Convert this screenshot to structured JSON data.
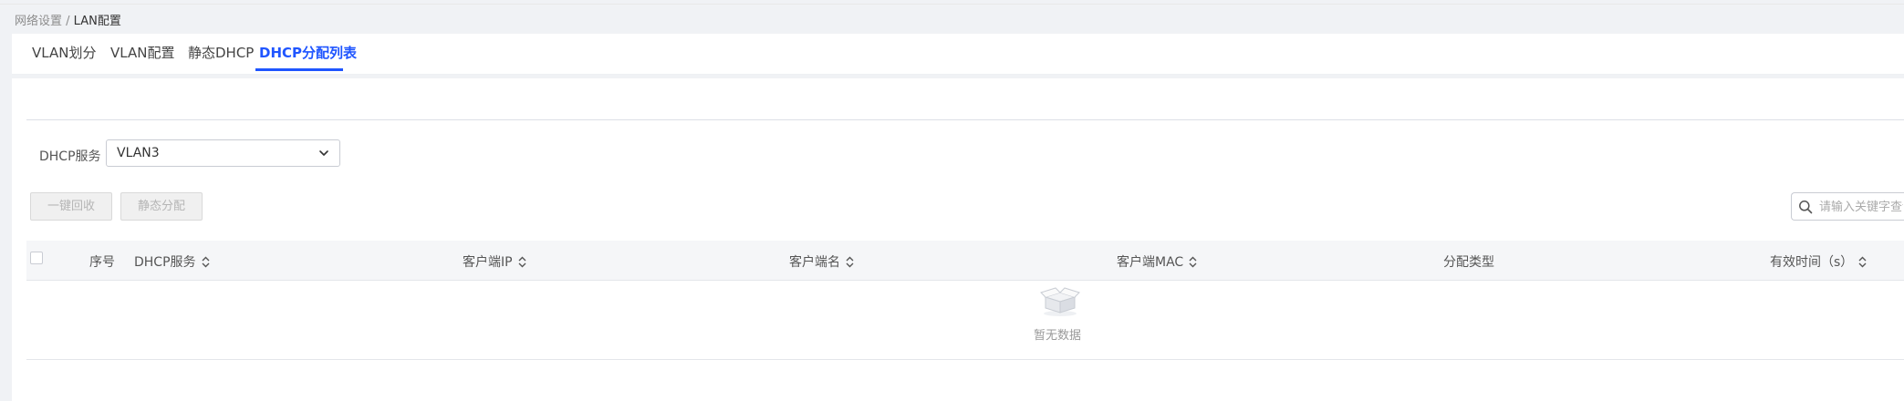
{
  "breadcrumb": {
    "parent": "网络设置",
    "separator": " / ",
    "current": "LAN配置"
  },
  "tabs": [
    {
      "label": "VLAN划分",
      "active": false
    },
    {
      "label": "VLAN配置",
      "active": false
    },
    {
      "label": "静态DHCP",
      "active": false
    },
    {
      "label": "DHCP分配列表",
      "active": true
    }
  ],
  "filter": {
    "label": "DHCP服务",
    "selected": "VLAN3"
  },
  "toolbar": {
    "reclaim_label": "一键回收",
    "static_assign_label": "静态分配"
  },
  "search": {
    "placeholder": "请输入关键字查询"
  },
  "table": {
    "columns": [
      {
        "label": "序号",
        "sortable": false
      },
      {
        "label": "DHCP服务",
        "sortable": true
      },
      {
        "label": "客户端IP",
        "sortable": true
      },
      {
        "label": "客户端名",
        "sortable": true
      },
      {
        "label": "客户端MAC",
        "sortable": true
      },
      {
        "label": "分配类型",
        "sortable": false
      },
      {
        "label": "有效时间（s）",
        "sortable": true
      }
    ],
    "empty_text": "暂无数据"
  },
  "colors": {
    "accent": "#1f55ff",
    "disabled_button_bg": "#f0f0f0",
    "header_bg": "#f5f6f8"
  }
}
